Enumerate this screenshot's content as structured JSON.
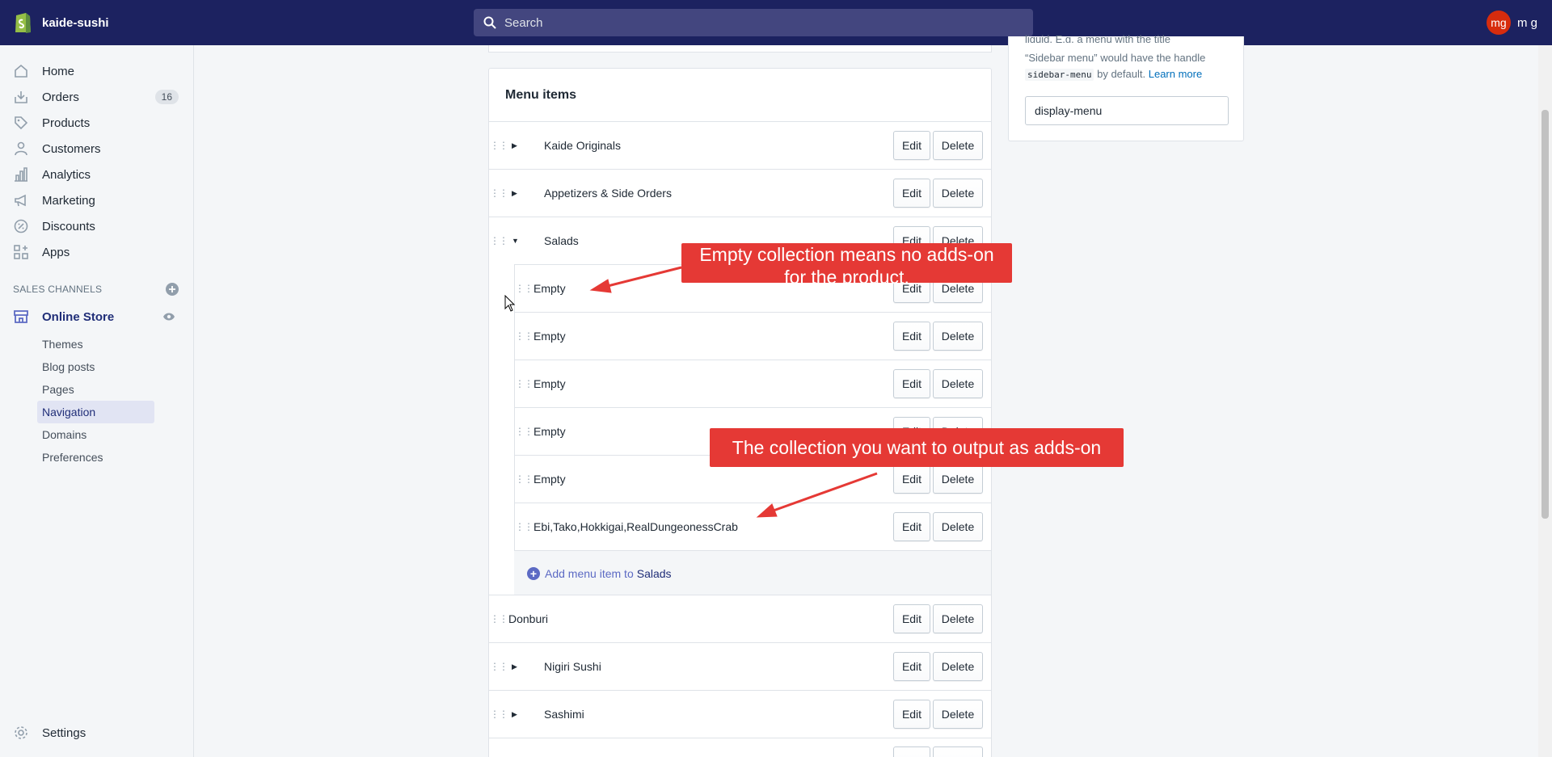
{
  "topbar": {
    "store_name": "kaide-sushi",
    "search_placeholder": "Search",
    "avatar_initials": "mg",
    "user_name": "m g"
  },
  "sidebar": {
    "items": [
      {
        "label": "Home",
        "icon": "home-icon"
      },
      {
        "label": "Orders",
        "icon": "orders-icon",
        "count": "16"
      },
      {
        "label": "Products",
        "icon": "tag-icon"
      },
      {
        "label": "Customers",
        "icon": "person-icon"
      },
      {
        "label": "Analytics",
        "icon": "bar-chart-icon"
      },
      {
        "label": "Marketing",
        "icon": "megaphone-icon"
      },
      {
        "label": "Discounts",
        "icon": "discount-icon"
      },
      {
        "label": "Apps",
        "icon": "apps-icon"
      }
    ],
    "sales_channels_title": "SALES CHANNELS",
    "online_store": "Online Store",
    "sub_items": [
      "Themes",
      "Blog posts",
      "Pages",
      "Navigation",
      "Domains",
      "Preferences"
    ],
    "active_sub_item": "Navigation",
    "settings": "Settings"
  },
  "menu": {
    "title": "Menu items",
    "edit_label": "Edit",
    "delete_label": "Delete",
    "top_items": [
      {
        "label": "Kaide Originals",
        "expanded": false
      },
      {
        "label": "Appetizers & Side Orders",
        "expanded": false
      },
      {
        "label": "Salads",
        "expanded": true
      }
    ],
    "salad_children": [
      "Empty",
      "Empty",
      "Empty",
      "Empty",
      "Empty",
      "Ebi,Tako,Hokkigai,RealDungeonessCrab"
    ],
    "add_item_prefix": "Add menu item to",
    "add_item_target": "Salads",
    "bottom_items": [
      {
        "label": "Donburi",
        "has_caret": false
      },
      {
        "label": "Nigiri Sushi",
        "has_caret": true
      },
      {
        "label": "Sashimi",
        "has_caret": true
      }
    ]
  },
  "handle_card": {
    "cut_text": "liquid. E.g. a menu with the title",
    "description_part1": "“Sidebar menu” would have the handle",
    "handle_code": "sidebar-menu",
    "description_part2": "by default.",
    "learn_more": "Learn more",
    "handle_value": "display-menu"
  },
  "annotations": {
    "callout1_line1": "Empty collection means no adds-on",
    "callout1_line2": "for the product.",
    "callout2": "The collection you want to output as adds-on",
    "color": "#e53935"
  },
  "colors": {
    "topbar": "#1c2260",
    "accent": "#5c6ac4",
    "active_nav_bg": "#e1e4f3"
  }
}
